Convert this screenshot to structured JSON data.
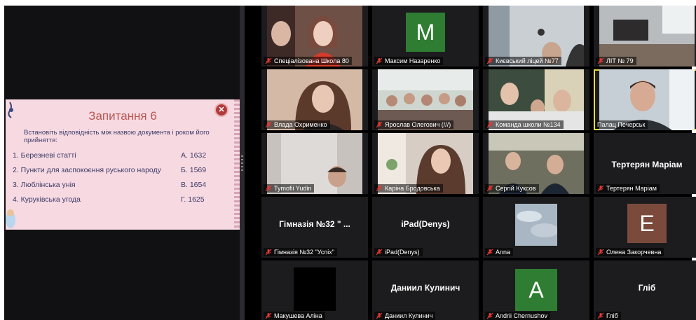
{
  "slide": {
    "title": "Запитання 6",
    "instruction": "Встановіть відповідність між назвою  документа і роком його прийняття:",
    "items": [
      {
        "left": "1. Березневі статті",
        "right": "А. 1632"
      },
      {
        "left": "2. Пункти для заспокоєння руського народу",
        "right": "Б. 1569"
      },
      {
        "left": "3. Люблінська унія",
        "right": "В. 1654"
      },
      {
        "left": "4. Куруківська угода",
        "right": "Г. 1625"
      }
    ],
    "close_glyph": "✕"
  },
  "participants": [
    {
      "name": "Спеціалізована Школа 80"
    },
    {
      "name": "Максим Назаренко",
      "avatar_letter": "M",
      "avatar_color": "#2e7d32"
    },
    {
      "name": "Києвський ліцей №77"
    },
    {
      "name": "ЛІТ № 79"
    },
    {
      "name": "Влада Охрименко"
    },
    {
      "name": "Ярослав Олегович (///)"
    },
    {
      "name": "Команда школи №134"
    },
    {
      "name": "Палац Печерськ"
    },
    {
      "name": "Tymofii Yudin"
    },
    {
      "name": "Каріна Бродовська"
    },
    {
      "name": "Сергій Куксов"
    },
    {
      "name": "Тертерян Маріам",
      "display_name": "Тертерян Маріам"
    },
    {
      "name": "Гімназія №32 \"Успіх\"",
      "display_name": "Гімназія №32 \" ..."
    },
    {
      "name": "iPad(Denys)",
      "display_name": "iPad(Denys)"
    },
    {
      "name": "Anna"
    },
    {
      "name": "Олена Закорчевна",
      "avatar_letter": "E",
      "avatar_color": "#7a4b3c"
    },
    {
      "name": "Макушева Аліна"
    },
    {
      "name": "Даниил Кулинич",
      "display_name": "Даниил Кулинич"
    },
    {
      "name": "Andrii Chernushov",
      "avatar_letter": "A",
      "avatar_color": "#2e7d32"
    },
    {
      "name": "Гліб",
      "display_name": "Гліб"
    }
  ],
  "colors": {
    "muted_mic": "#e53935",
    "active_speaker": "#e6d840"
  }
}
